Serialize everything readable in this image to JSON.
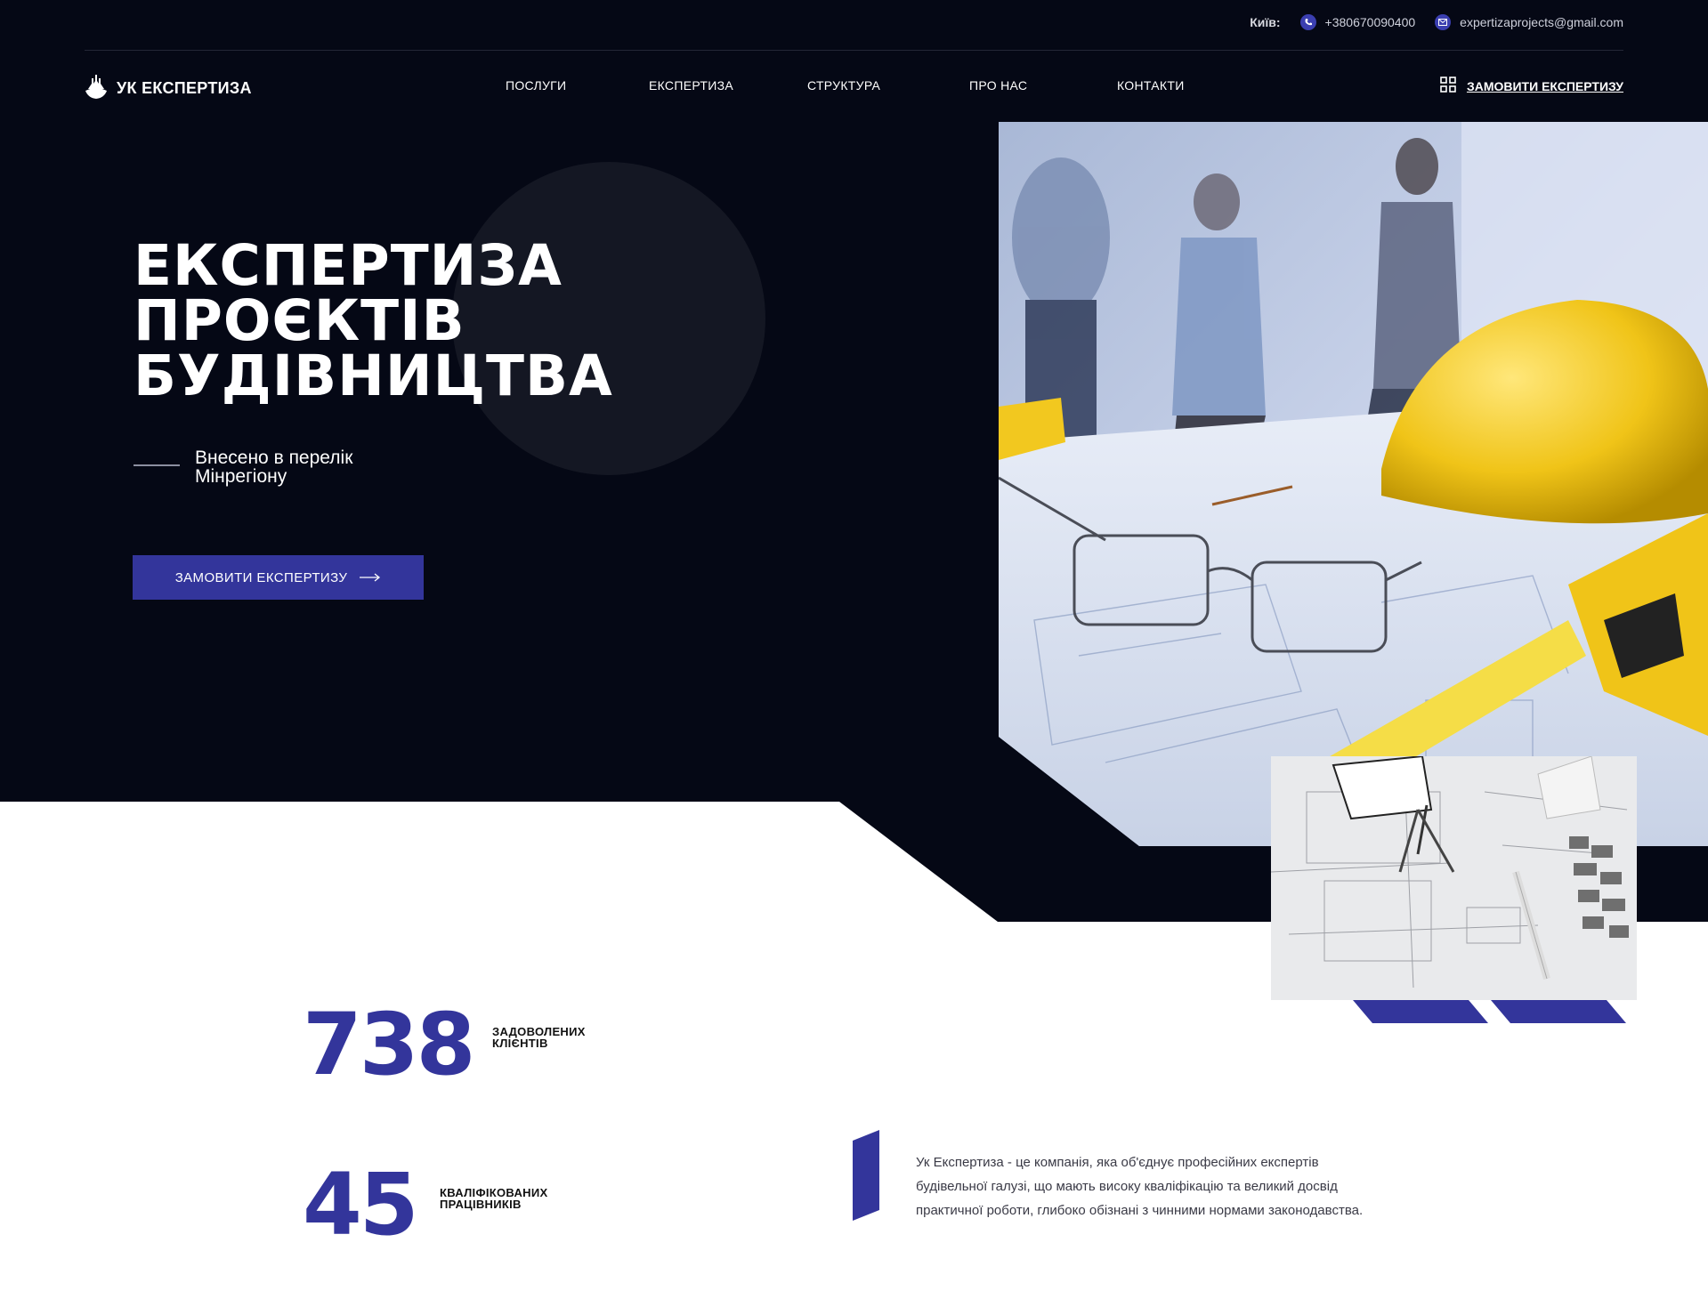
{
  "topbar": {
    "city": "Київ:",
    "phone": "+380670090400",
    "email": "expertizaprojects@gmail.com",
    "phone_icon": "phone-icon",
    "email_icon": "mail-icon"
  },
  "header": {
    "logo_text": "УК ЕКСПЕРТИЗА",
    "nav": [
      "ПОСЛУГИ",
      "ЕКСПЕРТИЗА",
      "СТРУКТУРА",
      "ПРО НАС",
      "КОНТАКТИ"
    ],
    "order_label": "ЗАМОВИТИ ЕКСПЕРТИЗУ",
    "order_icon": "grid-icon"
  },
  "hero": {
    "title_lines": [
      "ЕКСПЕРТИЗА",
      "ПРОЄКТІВ",
      "БУДІВНИЦТВА"
    ],
    "subtitle": "Внесено в перелік Мінрегіону",
    "cta_label": "ЗАМОВИТИ ЕКСПЕРТИЗУ",
    "cta_icon": "arrow-right-icon"
  },
  "stats": [
    {
      "value": "738",
      "label": "ЗАДОВОЛЕНИХ КЛІЄНТІВ"
    },
    {
      "value": "45",
      "label": "КВАЛІФІКОВАНИХ ПРАЦІВНИКІВ"
    }
  ],
  "about": {
    "text": "Ук Експертиза - це компанія, яка об'єднує професійних експертів будівельної галузі, що мають високу кваліфікацію та великий досвід практичної роботи, глибоко обізнані з чинними нормами законодавства."
  },
  "colors": {
    "dark": "#050815",
    "accent": "#33359b",
    "circle": "#141723"
  }
}
